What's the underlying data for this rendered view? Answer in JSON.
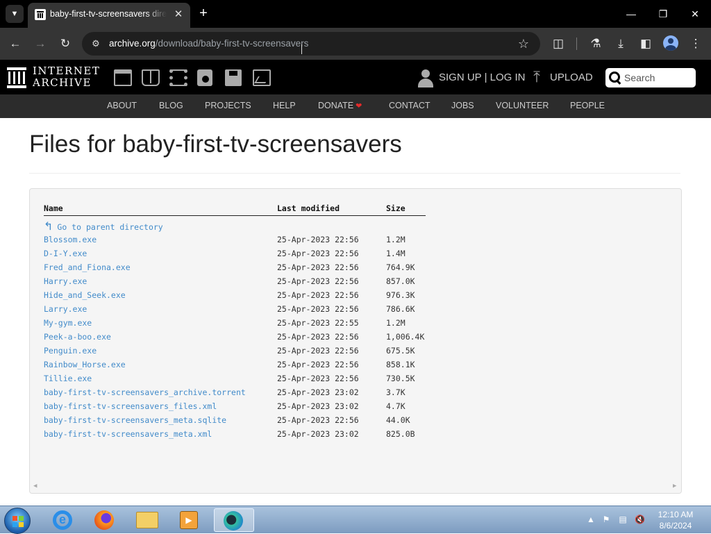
{
  "browser": {
    "tab_title": "baby-first-tv-screensavers directory listing",
    "url_host": "archive.org",
    "url_path": "/download/baby-first-tv-screensavers"
  },
  "ia_header": {
    "logo_line1": "INTERNET",
    "logo_line2": "ARCHIVE",
    "signup_label": "SIGN UP | LOG IN",
    "upload_label": "UPLOAD",
    "search_placeholder": "Search"
  },
  "ia_nav": [
    {
      "label": "ABOUT"
    },
    {
      "label": "BLOG"
    },
    {
      "label": "PROJECTS"
    },
    {
      "label": "HELP"
    },
    {
      "label": "DONATE"
    },
    {
      "label": "CONTACT"
    },
    {
      "label": "JOBS"
    },
    {
      "label": "VOLUNTEER"
    },
    {
      "label": "PEOPLE"
    }
  ],
  "page": {
    "title": "Files for baby-first-tv-screensavers",
    "columns": {
      "name": "Name",
      "modified": "Last modified",
      "size": "Size"
    },
    "parent_link": "Go to parent directory",
    "files": [
      {
        "name": "Blossom.exe",
        "modified": "25-Apr-2023 22:56",
        "size": "1.2M"
      },
      {
        "name": "D-I-Y.exe",
        "modified": "25-Apr-2023 22:56",
        "size": "1.4M"
      },
      {
        "name": "Fred_and_Fiona.exe",
        "modified": "25-Apr-2023 22:56",
        "size": "764.9K"
      },
      {
        "name": "Harry.exe",
        "modified": "25-Apr-2023 22:56",
        "size": "857.0K"
      },
      {
        "name": "Hide_and_Seek.exe",
        "modified": "25-Apr-2023 22:56",
        "size": "976.3K"
      },
      {
        "name": "Larry.exe",
        "modified": "25-Apr-2023 22:56",
        "size": "786.6K"
      },
      {
        "name": "My-gym.exe",
        "modified": "25-Apr-2023 22:55",
        "size": "1.2M"
      },
      {
        "name": "Peek-a-boo.exe",
        "modified": "25-Apr-2023 22:56",
        "size": "1,006.4K"
      },
      {
        "name": "Penguin.exe",
        "modified": "25-Apr-2023 22:56",
        "size": "675.5K"
      },
      {
        "name": "Rainbow_Horse.exe",
        "modified": "25-Apr-2023 22:56",
        "size": "858.1K"
      },
      {
        "name": "Tillie.exe",
        "modified": "25-Apr-2023 22:56",
        "size": "730.5K"
      },
      {
        "name": "baby-first-tv-screensavers_archive.torrent",
        "modified": "25-Apr-2023 23:02",
        "size": "3.7K"
      },
      {
        "name": "baby-first-tv-screensavers_files.xml",
        "modified": "25-Apr-2023 23:02",
        "size": "4.7K"
      },
      {
        "name": "baby-first-tv-screensavers_meta.sqlite",
        "modified": "25-Apr-2023 22:56",
        "size": "44.0K"
      },
      {
        "name": "baby-first-tv-screensavers_meta.xml",
        "modified": "25-Apr-2023 23:02",
        "size": "825.0B"
      }
    ]
  },
  "taskbar": {
    "time": "12:10 AM",
    "date": "8/6/2024"
  },
  "colors": {
    "link": "#428bca",
    "ia_header_bg": "#000000",
    "ia_nav_bg": "#2c2c2c",
    "chrome_toolbar": "#353535",
    "donate_heart": "#e52b2b"
  }
}
